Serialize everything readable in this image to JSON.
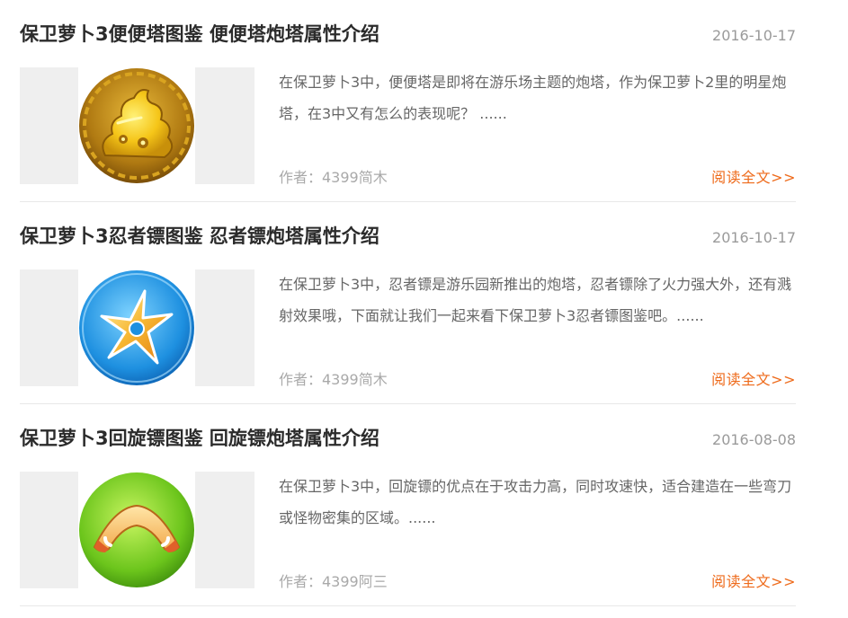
{
  "articles": [
    {
      "title": "保卫萝卜3便便塔图鉴 便便塔炮塔属性介绍",
      "date": "2016-10-17",
      "thumbnail_icon": "poop-tower-icon",
      "summary": "在保卫萝卜3中，便便塔是即将在游乐场主题的炮塔，作为保卫萝卜2里的明星炮塔，在3中又有怎么的表现呢？ ......",
      "author": "作者：4399简木",
      "read_more": "阅读全文>>"
    },
    {
      "title": "保卫萝卜3忍者镖图鉴 忍者镖炮塔属性介绍",
      "date": "2016-10-17",
      "thumbnail_icon": "ninja-star-tower-icon",
      "summary": "在保卫萝卜3中，忍者镖是游乐园新推出的炮塔，忍者镖除了火力强大外，还有溅射效果哦，下面就让我们一起来看下保卫萝卜3忍者镖图鉴吧。......",
      "author": "作者：4399简木",
      "read_more": "阅读全文>>"
    },
    {
      "title": "保卫萝卜3回旋镖图鉴 回旋镖炮塔属性介绍",
      "date": "2016-08-08",
      "thumbnail_icon": "boomerang-tower-icon",
      "summary": "在保卫萝卜3中，回旋镖的优点在于攻击力高，同时攻速快，适合建造在一些弯刀或怪物密集的区域。......",
      "author": "作者：4399阿三",
      "read_more": "阅读全文>>"
    }
  ],
  "colors": {
    "title": "#2b2b2b",
    "date": "#9a9a9a",
    "summary": "#666666",
    "author": "#a9a9a9",
    "read_more": "#ee6a1a",
    "thumb_bg": "#efefef"
  }
}
